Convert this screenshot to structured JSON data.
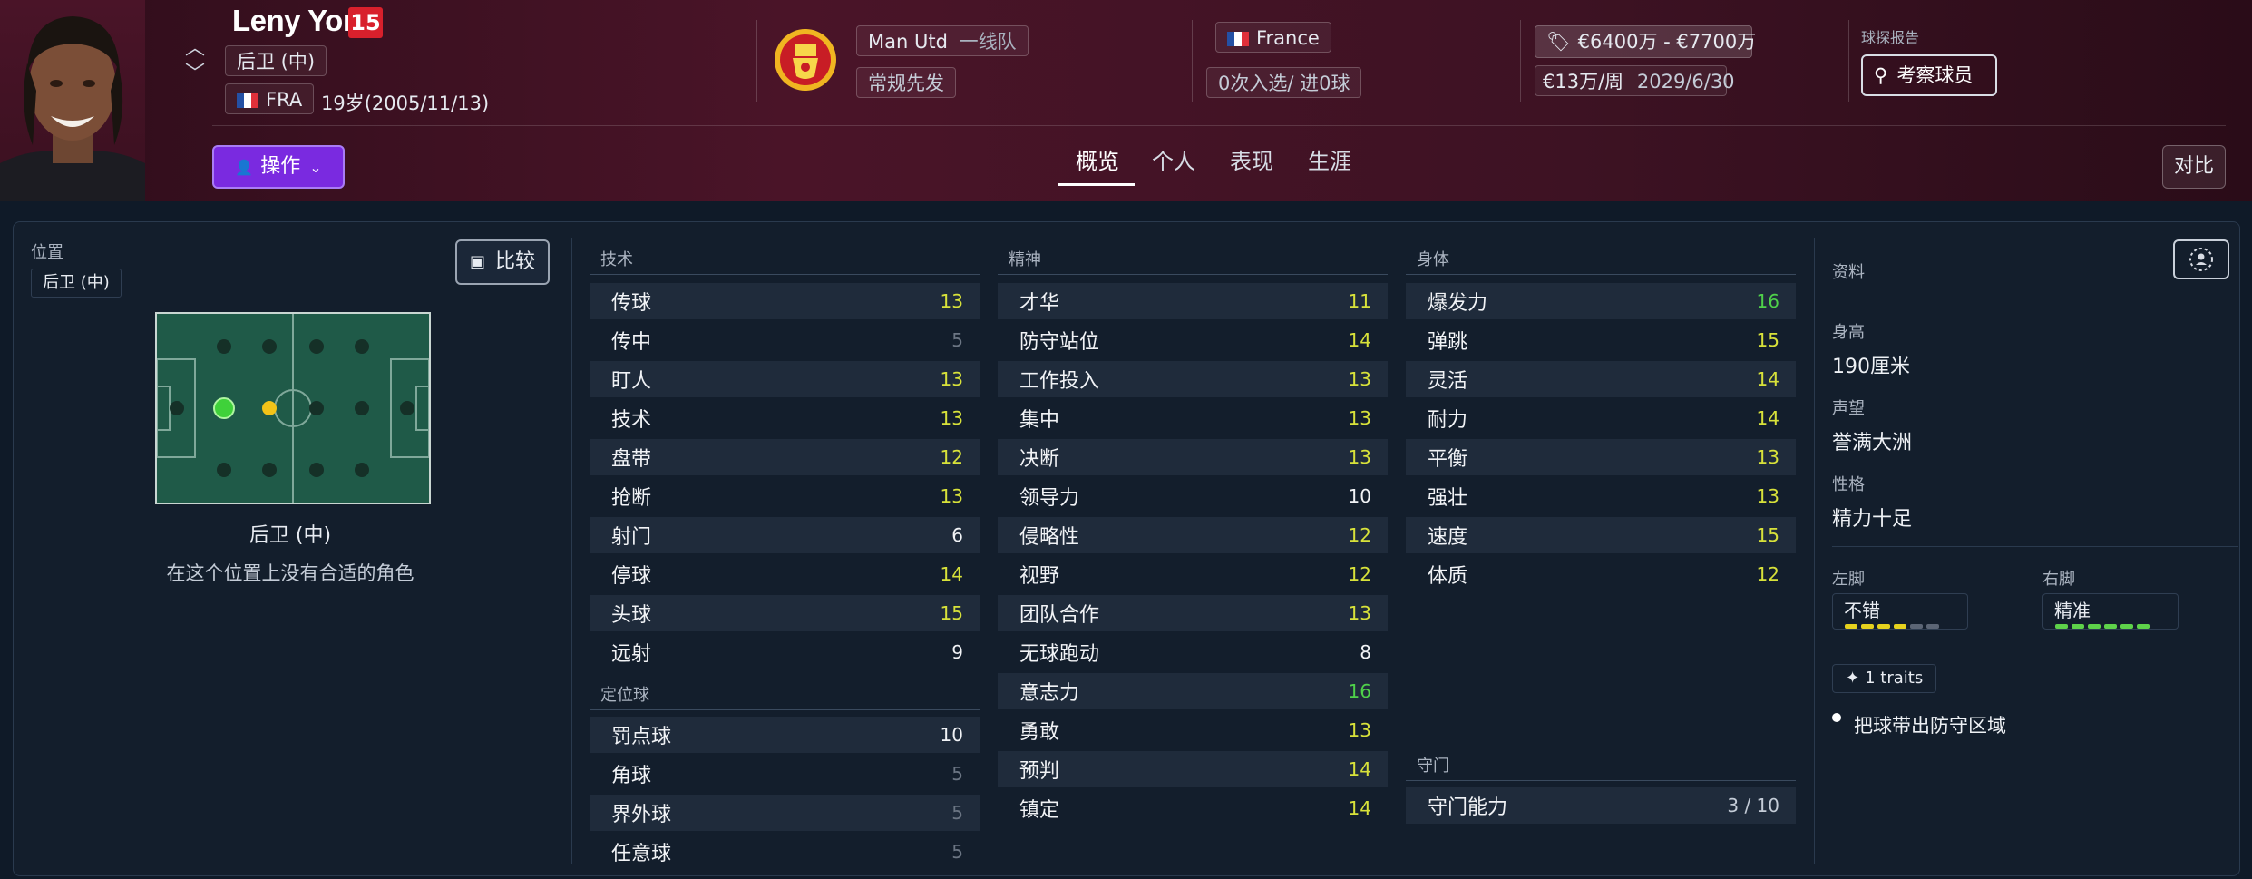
{
  "player": {
    "name": "Leny Yoro",
    "number": "15",
    "position_chip": "后卫 (中)",
    "nation_code": "FRA",
    "age_birth": "19岁(2005/11/13)"
  },
  "club": {
    "name": "Man Utd",
    "squad": "一线队",
    "role": "常规先发"
  },
  "nation": {
    "name": "France",
    "caps": "0次入选/ 进0球"
  },
  "finance": {
    "value": "€6400万 - €7700万",
    "wage": "€13万/周",
    "contract_end": "2029/6/30"
  },
  "scout": {
    "label": "球探报告",
    "button": "考察球员"
  },
  "actions": {
    "action_button": "操作",
    "compare_button": "对比"
  },
  "tabs": [
    {
      "label": "概览",
      "active": true
    },
    {
      "label": "个人",
      "active": false
    },
    {
      "label": "表现",
      "active": false
    },
    {
      "label": "生涯",
      "active": false
    }
  ],
  "position_panel": {
    "label": "位置",
    "chip": "后卫 (中)",
    "compare_button": "比较",
    "title": "后卫 (中)",
    "subtitle": "在这个位置上没有合适的角色"
  },
  "attributes": {
    "technical": {
      "title": "技术",
      "items": [
        {
          "name": "传球",
          "value": "13"
        },
        {
          "name": "传中",
          "value": "5"
        },
        {
          "name": "盯人",
          "value": "13"
        },
        {
          "name": "技术",
          "value": "13"
        },
        {
          "name": "盘带",
          "value": "12"
        },
        {
          "name": "抢断",
          "value": "13"
        },
        {
          "name": "射门",
          "value": "6"
        },
        {
          "name": "停球",
          "value": "14"
        },
        {
          "name": "头球",
          "value": "15"
        },
        {
          "name": "远射",
          "value": "9"
        }
      ]
    },
    "set_pieces": {
      "title": "定位球",
      "items": [
        {
          "name": "罚点球",
          "value": "10"
        },
        {
          "name": "角球",
          "value": "5"
        },
        {
          "name": "界外球",
          "value": "5"
        },
        {
          "name": "任意球",
          "value": "5"
        }
      ]
    },
    "mental": {
      "title": "精神",
      "items": [
        {
          "name": "才华",
          "value": "11"
        },
        {
          "name": "防守站位",
          "value": "14"
        },
        {
          "name": "工作投入",
          "value": "13"
        },
        {
          "name": "集中",
          "value": "13"
        },
        {
          "name": "决断",
          "value": "13"
        },
        {
          "name": "领导力",
          "value": "10"
        },
        {
          "name": "侵略性",
          "value": "12"
        },
        {
          "name": "视野",
          "value": "12"
        },
        {
          "name": "团队合作",
          "value": "13"
        },
        {
          "name": "无球跑动",
          "value": "8"
        },
        {
          "name": "意志力",
          "value": "16"
        },
        {
          "name": "勇敢",
          "value": "13"
        },
        {
          "name": "预判",
          "value": "14"
        },
        {
          "name": "镇定",
          "value": "14"
        }
      ]
    },
    "physical": {
      "title": "身体",
      "items": [
        {
          "name": "爆发力",
          "value": "16"
        },
        {
          "name": "弹跳",
          "value": "15"
        },
        {
          "name": "灵活",
          "value": "14"
        },
        {
          "name": "耐力",
          "value": "14"
        },
        {
          "name": "平衡",
          "value": "13"
        },
        {
          "name": "强壮",
          "value": "13"
        },
        {
          "name": "速度",
          "value": "15"
        },
        {
          "name": "体质",
          "value": "12"
        }
      ]
    },
    "goalkeeping": {
      "title": "守门",
      "items": [
        {
          "name": "守门能力",
          "value": "3 / 10"
        }
      ]
    }
  },
  "profile": {
    "title": "资料",
    "height_label": "身高",
    "height": "190厘米",
    "reputation_label": "声望",
    "reputation": "誉满大洲",
    "personality_label": "性格",
    "personality": "精力十足",
    "left_foot_label": "左脚",
    "left_foot": "不错",
    "left_foot_level": 4,
    "right_foot_label": "右脚",
    "right_foot": "精准",
    "right_foot_level": 6,
    "traits_chip": "1 traits",
    "trait": "把球带出防守区域"
  },
  "colors": {
    "value_white": "#f1f3f6",
    "value_grey": "#6c7684",
    "value_yellow": "#d8e23a",
    "value_green": "#4fd14a",
    "foot_yellow": "#e6d21e",
    "foot_green": "#5ed24a"
  }
}
